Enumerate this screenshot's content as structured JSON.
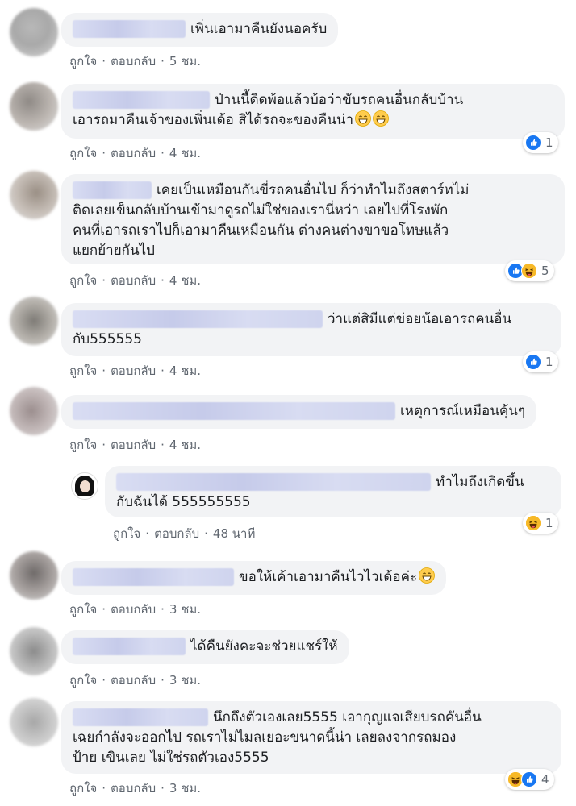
{
  "comments": [
    {
      "text": "เพิ่นเอามาคืนยังนอครับ",
      "like": "ถูกใจ",
      "reply": "ตอบกลับ",
      "time": "5 ชม."
    },
    {
      "text1": "ป่านนี้ดิดพ้อแล้วบ้อว่าขับรถคนอื่นกลับบ้าน",
      "text2": "เอารถมาคืนเจ้าของเพิ่นเด้อ สิได้รถจะของคืนน่า",
      "like": "ถูกใจ",
      "reply": "ตอบกลับ",
      "time": "4 ชม.",
      "reaction_count": "1"
    },
    {
      "text1": "เคยเป็นเหมือนกันขี่รถคนอื่นไป ก็ว่าทำไมถึงสตาร์ทไม่",
      "text2": "ติดเลยเข็นกลับบ้านเข้ามาดูรถไม่ใช่ของเรานี่หว่า เลยไปที่โรงพัก",
      "text3": "คนที่เอารถเราไปก็เอามาคืนเหมือนกัน ต่างคนต่างขาขอโทษแล้ว",
      "text4": "แยกย้ายกันไป",
      "like": "ถูกใจ",
      "reply": "ตอบกลับ",
      "time": "4 ชม.",
      "reaction_count": "5"
    },
    {
      "text1": "ว่าแต่สิมีแต่ข่อยน้อเอารถคนอื่น",
      "text2": "กับ555555",
      "like": "ถูกใจ",
      "reply": "ตอบกลับ",
      "time": "4 ชม.",
      "reaction_count": "1"
    },
    {
      "text": "เหตุการณ์เหมือนคุ้นๆ",
      "like": "ถูกใจ",
      "reply": "ตอบกลับ",
      "time": "4 ชม."
    },
    {
      "text1": "ทำไมถึงเกิดขึ้น",
      "text2": "กับฉันได้ 555555555",
      "like": "ถูกใจ",
      "reply": "ตอบกลับ",
      "time": "48 นาที",
      "reaction_count": "1"
    },
    {
      "text": "ขอให้เค้าเอามาคืนไวไวเด้อค่ะ",
      "like": "ถูกใจ",
      "reply": "ตอบกลับ",
      "time": "3 ชม."
    },
    {
      "text": "ได้คืนยังคะจะช่วยแชร์ให้",
      "like": "ถูกใจ",
      "reply": "ตอบกลับ",
      "time": "3 ชม."
    },
    {
      "text1": "นึกถึงตัวเองเลย5555 เอากุญแจเสียบรถคันอื่น",
      "text2": "เฉยกำลังจะออกไป รถเราไม่ไมลเยอะขนาดนี้น่า เลยลงจากรถมอง",
      "text3": "ป้าย เขินเลย ไม่ใช่รถตัวเอง5555",
      "like": "ถูกใจ",
      "reply": "ตอบกลับ",
      "time": "3 ชม.",
      "reaction_count": "4"
    }
  ],
  "colors": {
    "bubble": "#f2f3f5",
    "meta": "#606770",
    "like_blue": "#1877f2",
    "haha_yellow": "#f7b928"
  }
}
